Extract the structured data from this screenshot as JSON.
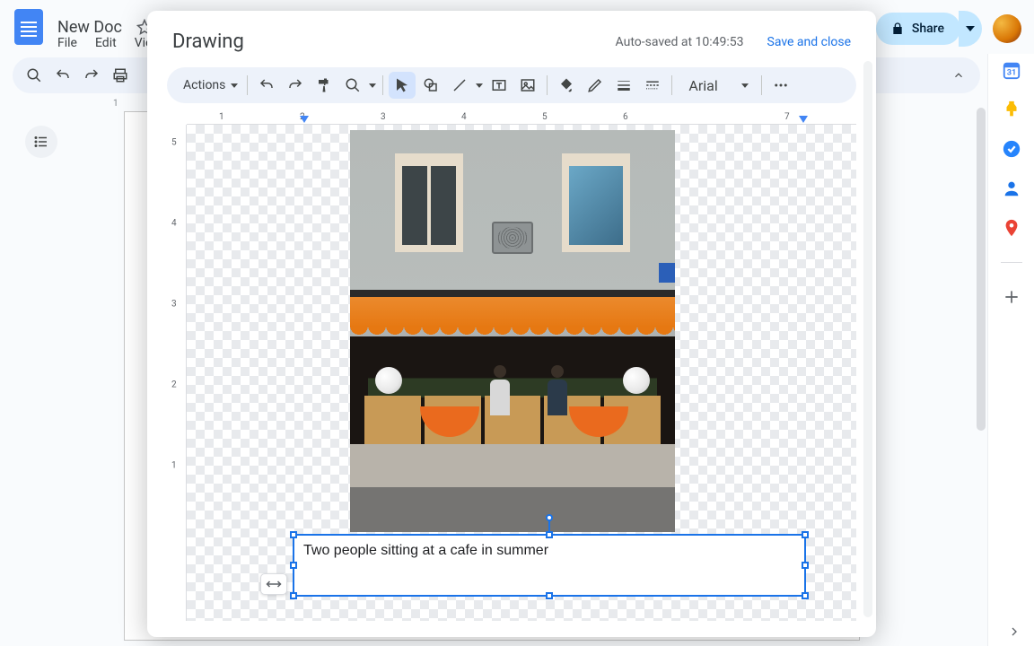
{
  "app": {
    "doc_title": "New Doc",
    "menu": {
      "file": "File",
      "edit": "Edit",
      "view": "View"
    },
    "share_label": "Share"
  },
  "ruler_background_tick": "1",
  "modal": {
    "title": "Drawing",
    "autosave_status": "Auto-saved at 10:49:53",
    "save_close": "Save and close",
    "actions_label": "Actions",
    "font_name": "Arial",
    "ruler_h": {
      "t1": "1",
      "t2": "2",
      "t3": "3",
      "t4": "4",
      "t5": "5",
      "t6": "6",
      "t7": "7"
    },
    "ruler_v": {
      "t1": "1",
      "t2": "2",
      "t3": "3",
      "t4": "4",
      "t5": "5"
    },
    "textbox_content": "Two people sitting at a cafe in summer"
  }
}
